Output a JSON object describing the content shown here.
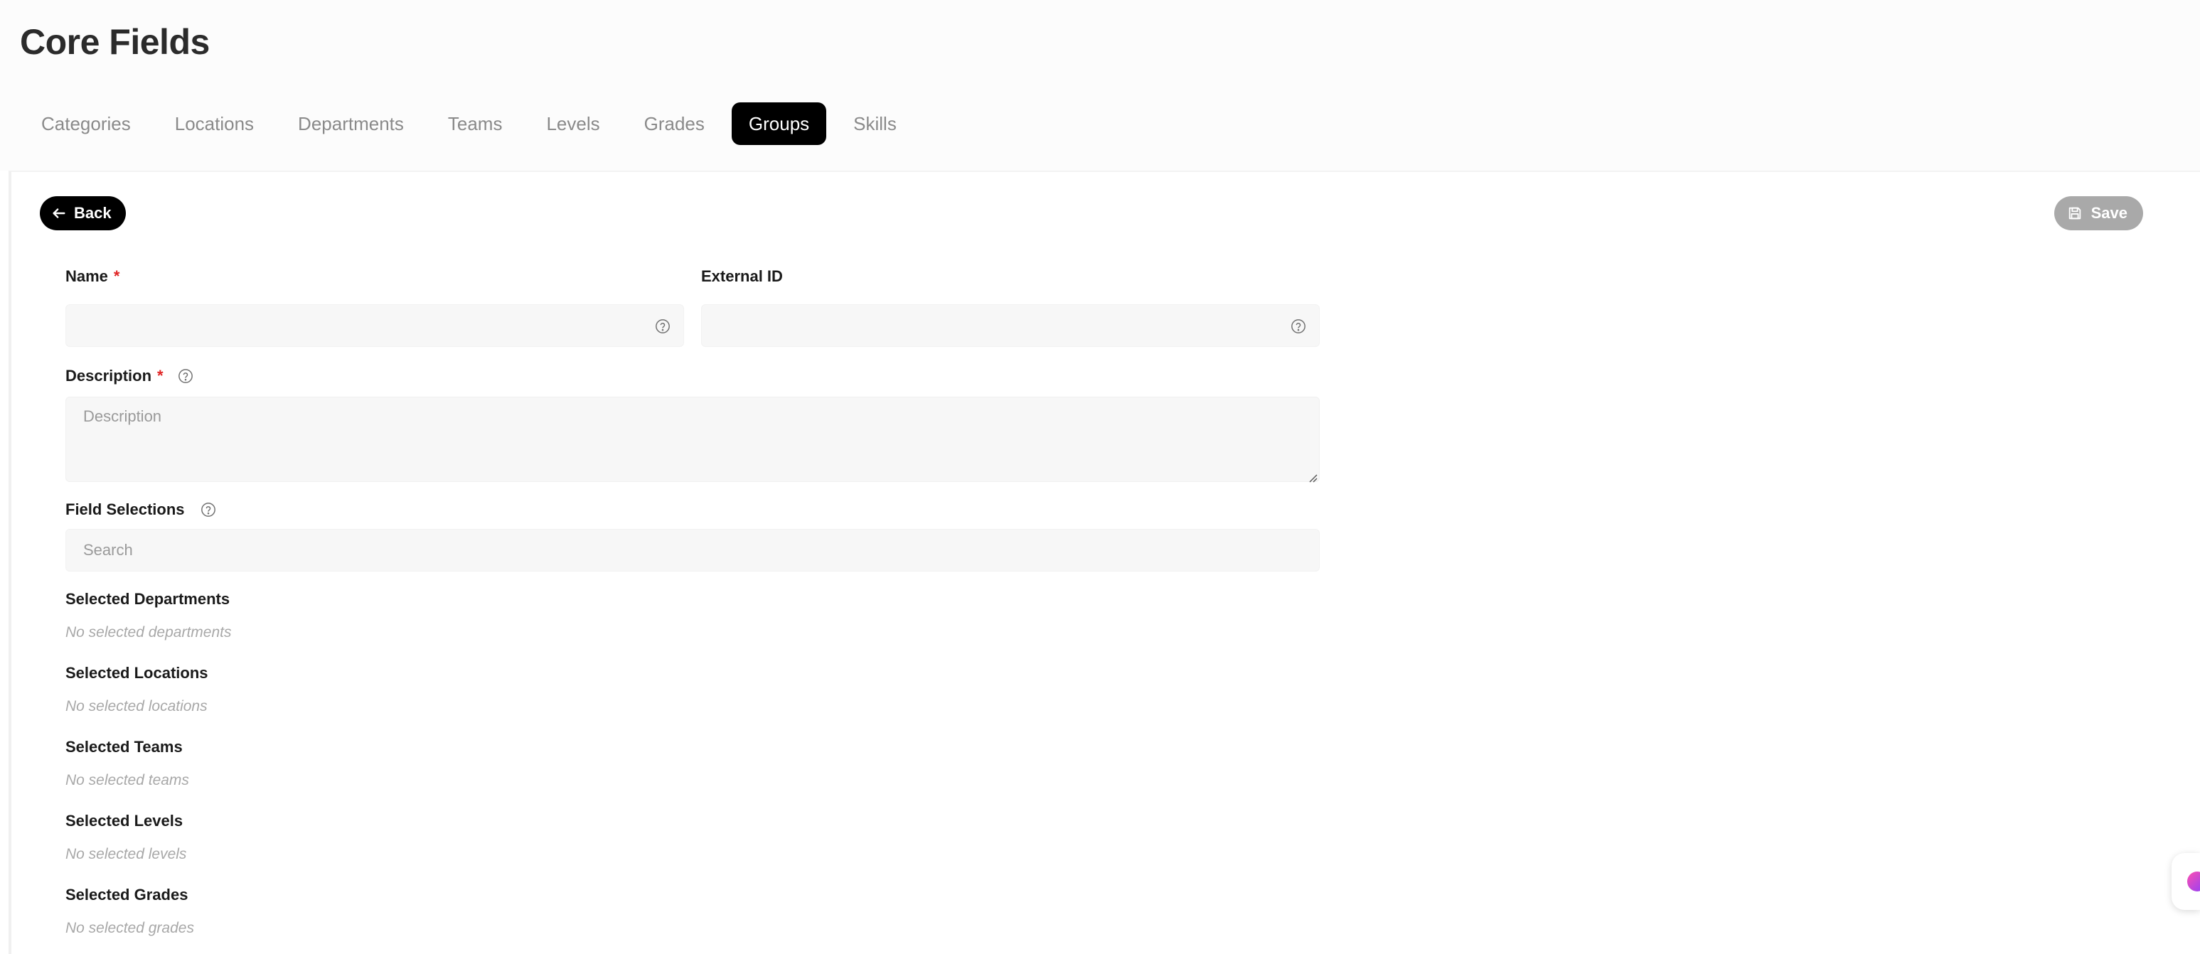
{
  "page": {
    "title": "Core Fields"
  },
  "tabs": [
    {
      "label": "Categories",
      "active": false
    },
    {
      "label": "Locations",
      "active": false
    },
    {
      "label": "Departments",
      "active": false
    },
    {
      "label": "Teams",
      "active": false
    },
    {
      "label": "Levels",
      "active": false
    },
    {
      "label": "Grades",
      "active": false
    },
    {
      "label": "Groups",
      "active": true
    },
    {
      "label": "Skills",
      "active": false
    }
  ],
  "toolbar": {
    "back_label": "Back",
    "save_label": "Save"
  },
  "form": {
    "name": {
      "label": "Name",
      "required": "*",
      "value": ""
    },
    "external_id": {
      "label": "External ID",
      "value": ""
    },
    "description": {
      "label": "Description",
      "required": "*",
      "placeholder": "Description"
    },
    "field_selections": {
      "label": "Field Selections",
      "placeholder": "Search"
    }
  },
  "selections": [
    {
      "label": "Selected Departments",
      "empty": "No selected departments"
    },
    {
      "label": "Selected Locations",
      "empty": "No selected locations"
    },
    {
      "label": "Selected Teams",
      "empty": "No selected teams"
    },
    {
      "label": "Selected Levels",
      "empty": "No selected levels"
    },
    {
      "label": "Selected Grades",
      "empty": "No selected grades"
    }
  ],
  "icons": {
    "back": "arrow-left-icon",
    "save": "floppy-disk-icon",
    "help": "question-circle-icon",
    "chat": "chat-widget-icon"
  },
  "colors": {
    "active_tab_bg": "#000000",
    "required": "#e02424",
    "save_disabled": "#a9a9a9",
    "input_bg": "#f7f7f7"
  }
}
